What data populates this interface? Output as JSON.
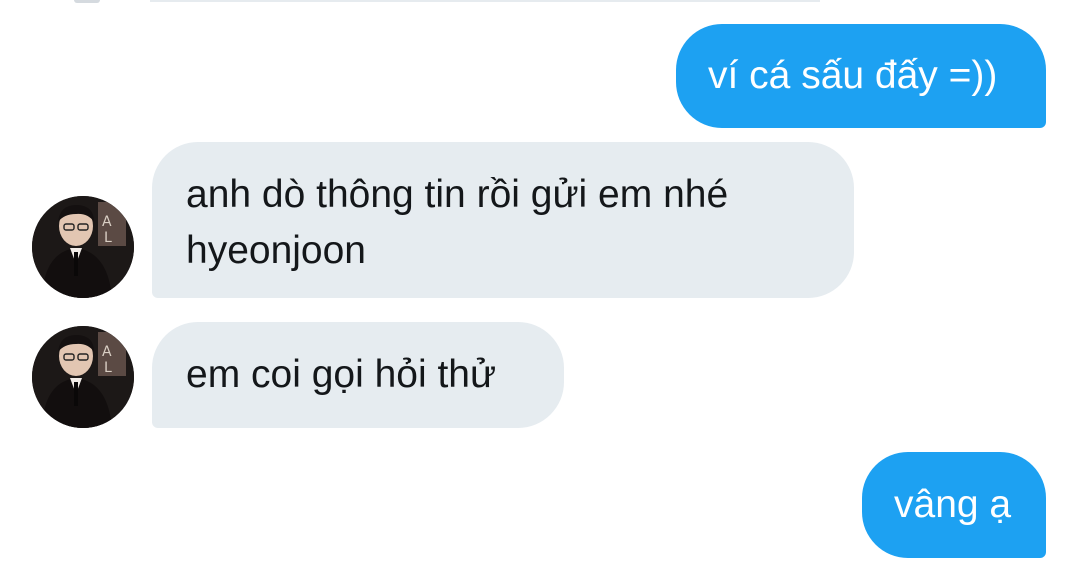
{
  "colors": {
    "outgoing_bubble": "#1da1f2",
    "incoming_bubble": "#e6ecf0",
    "incoming_text": "#14171a",
    "outgoing_text": "#ffffff"
  },
  "messages": [
    {
      "direction": "outgoing",
      "text": "ví cá sấu đấy =))"
    },
    {
      "direction": "incoming",
      "lines": [
        "anh dò thông tin rồi gửi em nhé",
        "hyeonjoon"
      ],
      "avatar": "profile-photo"
    },
    {
      "direction": "incoming",
      "text": "em coi gọi hỏi thử",
      "avatar": "profile-photo"
    },
    {
      "direction": "outgoing",
      "text": "vâng ạ"
    }
  ]
}
